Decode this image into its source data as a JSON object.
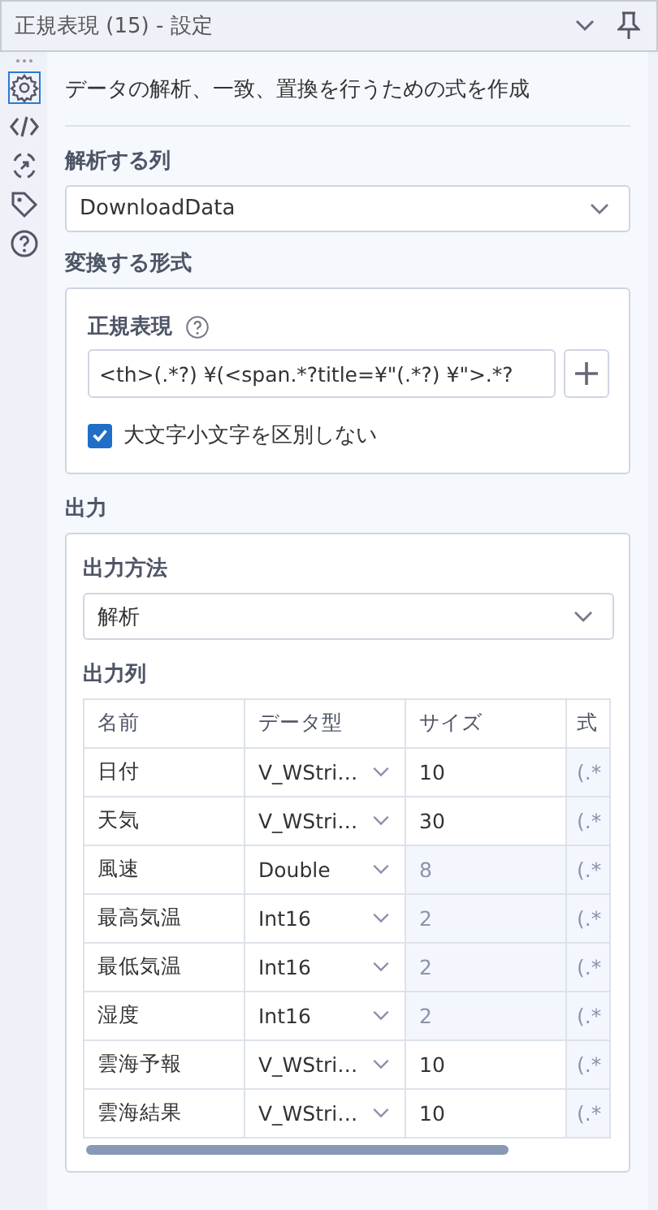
{
  "window": {
    "title": "正規表現 (15) - 設定"
  },
  "sidebar": {
    "items": [
      {
        "kind": "settings",
        "selected": true
      },
      {
        "kind": "code",
        "selected": false
      },
      {
        "kind": "connect",
        "selected": false
      },
      {
        "kind": "tag",
        "selected": false
      },
      {
        "kind": "help",
        "selected": false
      }
    ]
  },
  "description": "データの解析、一致、置換を行うための式を作成",
  "parse_column": {
    "label": "解析する列",
    "value": "DownloadData"
  },
  "format": {
    "label": "変換する形式",
    "regex_label": "正規表現",
    "regex_value": "<th>(.*?) ¥(<span.*?title=¥\"(.*?) ¥\">.*?",
    "case_insensitive": {
      "label": "大文字小文字を区別しない",
      "checked": true
    }
  },
  "output": {
    "label": "出力",
    "method_label": "出力方法",
    "method_value": "解析",
    "columns_label": "出力列",
    "table": {
      "columns": [
        "名前",
        "データ型",
        "サイズ",
        "式"
      ],
      "rows": [
        {
          "name": "日付",
          "type": "V_WStri…",
          "size": "10",
          "size_disabled": false,
          "expr": "(.*"
        },
        {
          "name": "天気",
          "type": "V_WStri…",
          "size": "30",
          "size_disabled": false,
          "expr": "(.*"
        },
        {
          "name": "風速",
          "type": "Double",
          "size": "8",
          "size_disabled": true,
          "expr": "(.*"
        },
        {
          "name": "最高気温",
          "type": "Int16",
          "size": "2",
          "size_disabled": true,
          "expr": "(.*"
        },
        {
          "name": "最低気温",
          "type": "Int16",
          "size": "2",
          "size_disabled": true,
          "expr": "(.*"
        },
        {
          "name": "湿度",
          "type": "Int16",
          "size": "2",
          "size_disabled": true,
          "expr": "(.*"
        },
        {
          "name": "雲海予報",
          "type": "V_WStri…",
          "size": "10",
          "size_disabled": false,
          "expr": "(.*"
        },
        {
          "name": "雲海結果",
          "type": "V_WStri…",
          "size": "10",
          "size_disabled": false,
          "expr": "(.*"
        }
      ]
    }
  }
}
